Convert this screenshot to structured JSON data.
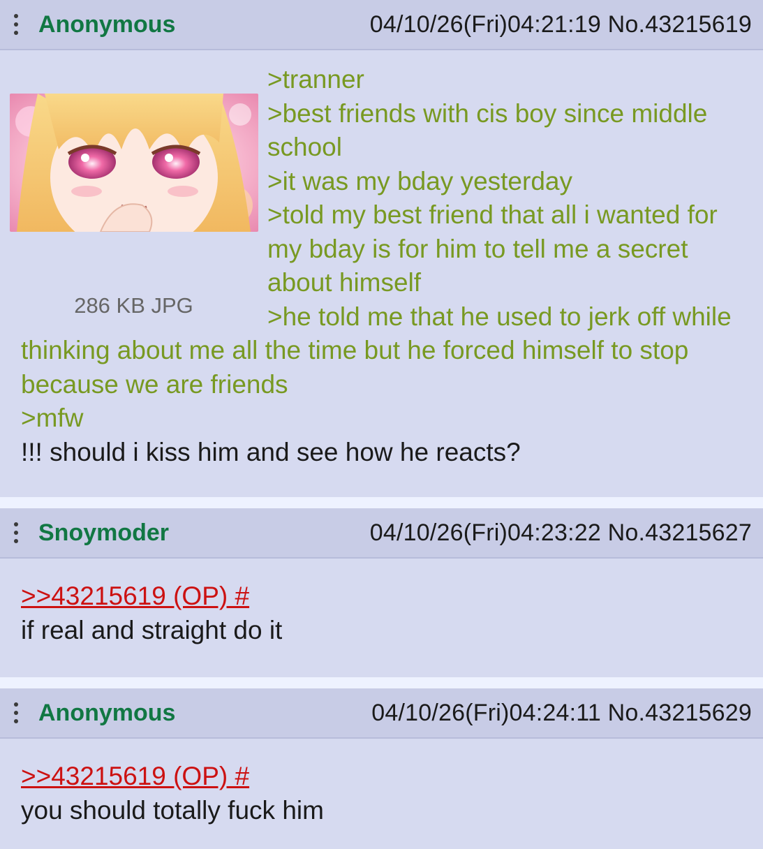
{
  "posts": [
    {
      "name": "Anonymous",
      "datetime": "04/10/26(Fri)04:21:19",
      "number": "No.43215619",
      "file_info": "286 KB JPG",
      "lines": [
        {
          "text": ">tranner",
          "green": true
        },
        {
          "text": ">best friends with cis boy since middle school",
          "green": true
        },
        {
          "text": ">it was my bday yesterday",
          "green": true
        },
        {
          "text": ">told my best friend that all i wanted for my bday is for him to tell me a secret about himself",
          "green": true
        },
        {
          "text": ">he told me that he used to jerk off while thinking about me all the time but he forced himself to stop because we are friends",
          "green": true
        },
        {
          "text": ">mfw",
          "green": true
        },
        {
          "text": "!!! should i kiss him and see how he reacts?",
          "green": false
        }
      ]
    },
    {
      "name": "Snoymoder",
      "datetime": "04/10/26(Fri)04:23:22",
      "number": "No.43215627",
      "quote_link": ">>43215619 (OP) #",
      "text": "if real and straight do it"
    },
    {
      "name": "Anonymous",
      "datetime": "04/10/26(Fri)04:24:11",
      "number": "No.43215629",
      "quote_link": ">>43215619 (OP) #",
      "text": "you should totally fuck him"
    }
  ],
  "colors": {
    "name": "#117743",
    "greentext": "#789922",
    "quotelink": "#cc1111",
    "post_bg": "#d6daf0",
    "header_bg": "#c8cce6"
  },
  "icons": {
    "menu": "vertical-dots-icon",
    "thumbnail": "anime-girl-thumbnail"
  }
}
